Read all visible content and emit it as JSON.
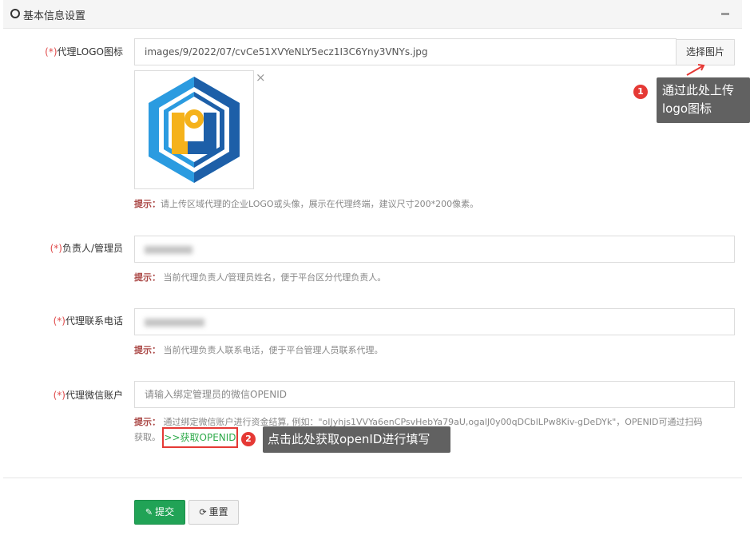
{
  "panel": {
    "title": "基本信息设置"
  },
  "logo_field": {
    "required_mark": "(*)",
    "label": "代理LOGO图标",
    "value": "images/9/2022/07/cvCe51XVYeNLY5ecz1I3C6Yny3VNYs.jpg",
    "pick_button": "选择图片",
    "remove_symbol": "×",
    "hint_key": "提示：",
    "hint_text": "请上传区域代理的企业LOGO或头像，展示在代理终端，建议尺寸200*200像素。"
  },
  "manager_field": {
    "required_mark": "(*)",
    "label": "负责人/管理员",
    "hint_key": "提示：",
    "hint_text": " 当前代理负责人/管理员姓名，便于平台区分代理负责人。"
  },
  "phone_field": {
    "required_mark": "(*)",
    "label": "代理联系电话",
    "hint_key": "提示：",
    "hint_text": " 当前代理负责人联系电话，便于平台管理人员联系代理。"
  },
  "wechat_field": {
    "required_mark": "(*)",
    "label": "代理微信账户",
    "placeholder": "请输入绑定管理员的微信OPENID",
    "hint_key": "提示：",
    "hint_line1": " 通过绑定微信账户进行资金结算, 例如：\"oIJyhjs1VVYa6enCPsvHebYa79aU,ogalJ0y00qDCblLPw8Kiv-gDeDYk\"，OPENID可通过扫码",
    "hint_line2": "获取。",
    "get_openid_link": ">>获取OPENID"
  },
  "annotations": {
    "badge1": "1",
    "callout1_line1": "通过此处上传",
    "callout1_line2": "logo图标",
    "badge2": "2",
    "callout2": "点击此处获取openID进行填写"
  },
  "actions": {
    "submit_label": "提交",
    "reset_label": "重置",
    "submit_icon": "pencil-icon",
    "reset_icon": "refresh-icon"
  },
  "colors": {
    "required": "#e04a4a",
    "hint_key": "#a94442",
    "submit": "#21a356",
    "link": "#2eaa4a",
    "annotation_red": "#e53935",
    "callout_bg": "#616161",
    "logo_blue": "#1d6fb8",
    "logo_light_blue": "#2b9be0",
    "logo_yellow": "#f5b21b"
  }
}
